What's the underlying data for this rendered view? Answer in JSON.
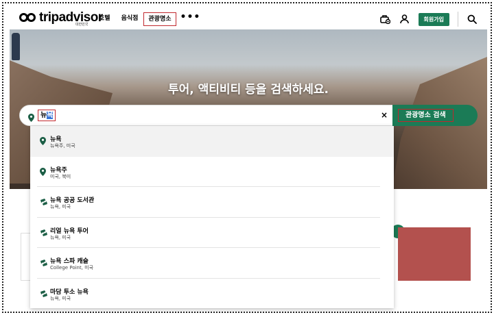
{
  "header": {
    "logo_text": "tripadvisor",
    "logo_sub": "대한민국",
    "nav": [
      "호텔",
      "음식점",
      "관광명소"
    ],
    "more": "•••",
    "signup_label": "회원가입"
  },
  "hero": {
    "title": "투어, 액티비티 등을 검색하세요."
  },
  "search": {
    "query_plain": "뉴",
    "query_highlight": "욕",
    "clear": "×",
    "button_label": "관광명소 검색"
  },
  "suggestions": [
    {
      "name": "뉴욕",
      "sub": "뉴욕주, 미국",
      "icon": "location-pin-icon"
    },
    {
      "name": "뉴욕주",
      "sub": "미국, 북미",
      "icon": "location-pin-icon"
    },
    {
      "name": "뉴욕 공공 도서관",
      "sub": "뉴욕, 미국",
      "icon": "ticket-icon"
    },
    {
      "name": "리얼 뉴욕 투어",
      "sub": "뉴욕, 미국",
      "icon": "ticket-icon"
    },
    {
      "name": "뉴욕 스파 캐슬",
      "sub": "College Point, 미국",
      "icon": "ticket-icon"
    },
    {
      "name": "마담 투소 뉴욕",
      "sub": "뉴욕, 미국",
      "icon": "ticket-icon"
    }
  ],
  "colors": {
    "brand_green": "#1b7b56",
    "annotation_red": "#c0272d",
    "redacted_block": "#b3514e"
  }
}
